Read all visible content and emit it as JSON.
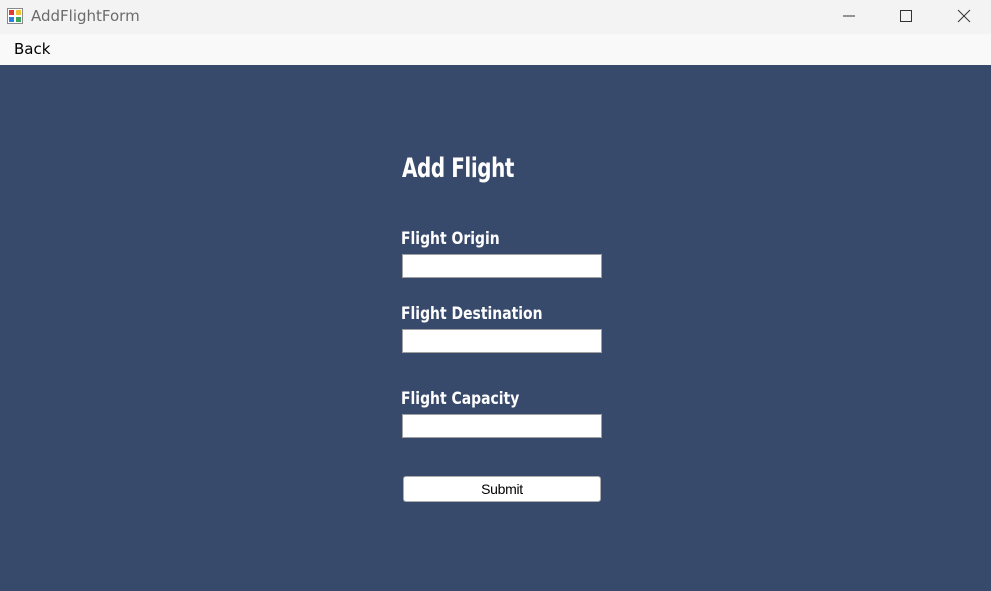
{
  "window": {
    "title": "AddFlightForm",
    "icon": "winforms-app-icon",
    "controls": [
      "minimize-icon",
      "maximize-icon",
      "close-icon"
    ]
  },
  "menu": {
    "back_label": "Back"
  },
  "form": {
    "heading": "Add Flight",
    "background_color": "#384a6c",
    "fields": [
      {
        "label": "Flight Origin",
        "value": ""
      },
      {
        "label": "Flight Destination",
        "value": ""
      },
      {
        "label": "Flight Capacity",
        "value": ""
      }
    ],
    "submit_label": "Submit"
  }
}
